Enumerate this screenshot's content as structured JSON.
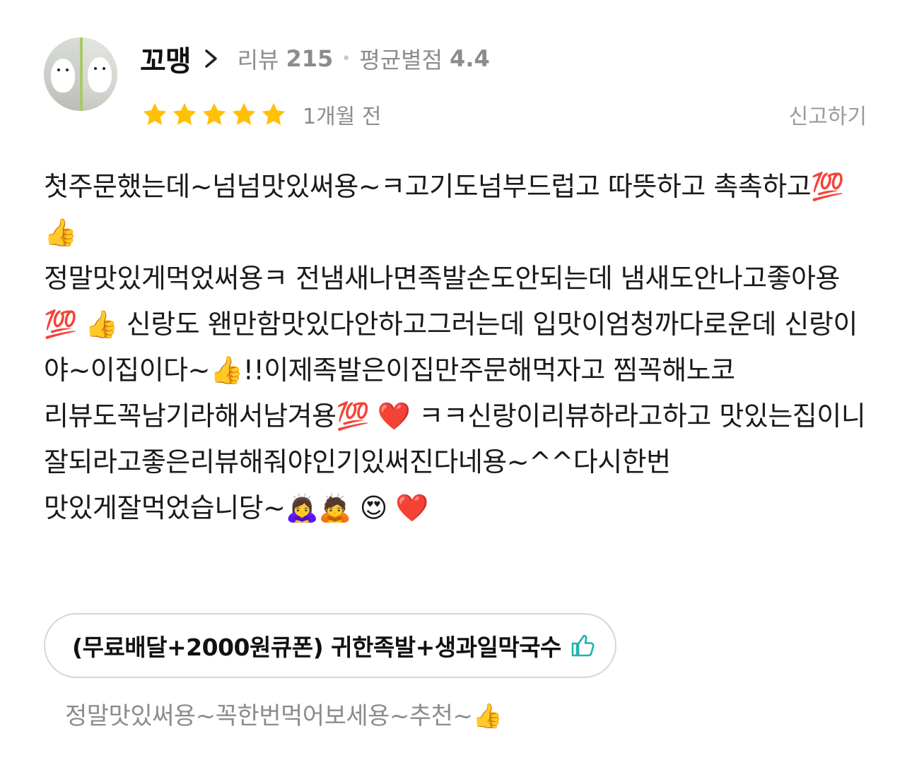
{
  "reviewer": {
    "name": "꼬맹",
    "review_label": "리뷰",
    "review_count": "215",
    "rating_label": "평균별점",
    "avg_rating": "4.4"
  },
  "review": {
    "stars": 5,
    "star_color": "#FFC107",
    "time_ago": "1개월 전",
    "report_label": "신고하기",
    "text": "첫주문했는데~넘넘맛있써용~ㅋ고기도넘부드럽고 따뜻하고 촉촉하고💯 👍\n정말맛있게먹었써용ㅋ 전냄새나면족발손도안되는데 냄새도안나고좋아용💯 👍 신랑도 왠만함맛있다안하고그러는데 입맛이엄청까다로운데 신랑이 야~이집이다~👍!!이제족발은이집만주문해먹자고 찜꼭해노코 리뷰도꼭남기라해서남겨용💯 ❤️ ㅋㅋ신랑이리뷰하라고하고 맛있는집이니 잘되라고좋은리뷰해줘야인기있써진다네용~^^다시한번 맛있게잘먹었습니당~🙇‍♀️🙇 😍 ❤️"
  },
  "menu": {
    "name": "(무료배달+2000원큐폰) 귀한족발+생과일막국수",
    "thumb_icon": "thumbs-up-outline-icon",
    "icon_color": "#20B2AA",
    "comment": "정말맛있써용~꼭한번먹어보세용~추천~👍"
  }
}
